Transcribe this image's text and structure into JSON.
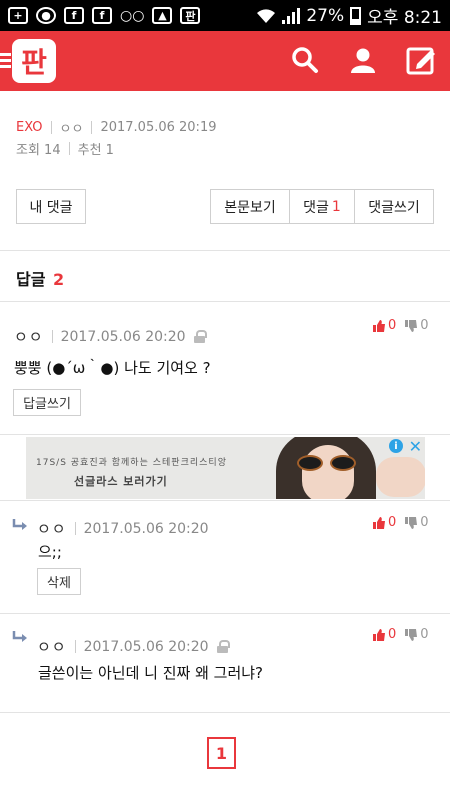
{
  "status_bar": {
    "battery": "27%",
    "time": "오후 8:21"
  },
  "header": {
    "logo_text": "판",
    "brand_color": "#e9373c"
  },
  "article": {
    "category": "EXO",
    "author": "ㅇㅇ",
    "datetime": "2017.05.06 20:19",
    "views": "조회 14",
    "recommends": "추천 1"
  },
  "buttons": {
    "my_comments": "내 댓글",
    "view_article": "본문보기",
    "comments_label": "댓글",
    "comments_count": "1",
    "write_comment": "댓글쓰기"
  },
  "replies": {
    "label": "답글",
    "count": "2"
  },
  "comments": [
    {
      "nickname": "ㅇㅇ",
      "datetime": "2017.05.06 20:20",
      "text": "뿡뿡 (●´ω｀●) 나도 기여오 ?",
      "button": "답글쓰기",
      "likes": "0",
      "dislikes": "0"
    },
    {
      "nickname": "ㅇㅇ",
      "datetime": "2017.05.06 20:20",
      "text": "으;;",
      "button": "삭제",
      "likes": "0",
      "dislikes": "0"
    },
    {
      "nickname": "ㅇㅇ",
      "datetime": "2017.05.06 20:20",
      "text": "글쓴이는 아닌데 니 진짜 왜 그러냐?",
      "likes": "0",
      "dislikes": "0"
    }
  ],
  "ad": {
    "line1": "17S/S 공효진과 함께하는 스테판크리스티앙",
    "line2": "선글라스 보러가기"
  },
  "pagination": {
    "current": "1"
  }
}
